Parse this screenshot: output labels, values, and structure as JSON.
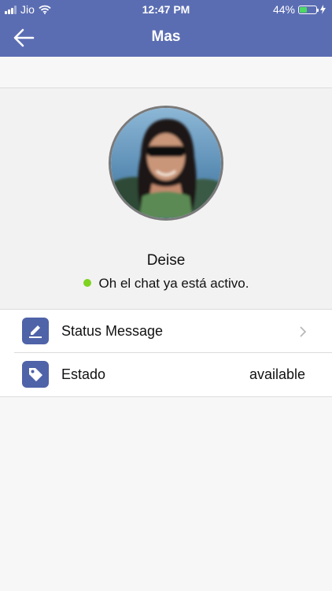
{
  "status_bar": {
    "carrier": "Jio",
    "time": "12:47 PM",
    "battery": "44%",
    "battery_level": 0.44
  },
  "navbar": {
    "title": "Mas"
  },
  "profile": {
    "name": "Deise",
    "status_text": "Oh el chat ya está activo.",
    "presence_color": "#7ed321"
  },
  "list": {
    "items": [
      {
        "label": "Status Message",
        "icon": "pencil-icon",
        "value": ""
      },
      {
        "label": "Estado",
        "icon": "tag-icon",
        "value": "available"
      }
    ]
  },
  "colors": {
    "header": "#5b6db2",
    "icon_bg": "#4f63a8",
    "battery": "#4cd964"
  }
}
